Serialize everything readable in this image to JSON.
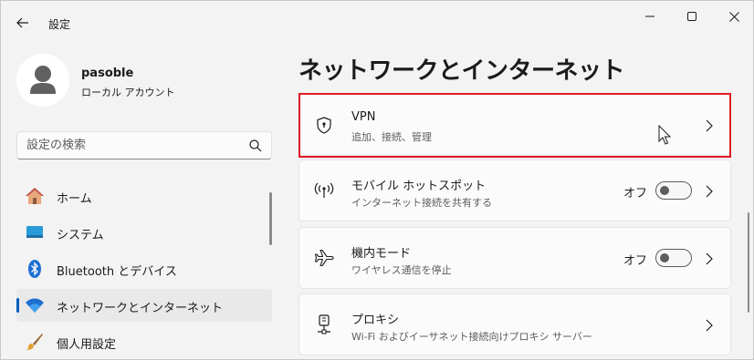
{
  "titlebar": {
    "title": "設定",
    "icons": {
      "back": "back-arrow-icon",
      "minimize": "minimize-icon",
      "maximize": "maximize-icon",
      "close": "close-icon"
    }
  },
  "user": {
    "name": "pasoble",
    "account_type": "ローカル アカウント"
  },
  "search": {
    "placeholder": "設定の検索",
    "value": ""
  },
  "sidebar": {
    "items": [
      {
        "label": "ホーム",
        "icon": "home-icon",
        "selected": false
      },
      {
        "label": "システム",
        "icon": "system-display-icon",
        "selected": false
      },
      {
        "label": "Bluetooth とデバイス",
        "icon": "bluetooth-icon",
        "selected": false
      },
      {
        "label": "ネットワークとインターネット",
        "icon": "wifi-icon",
        "selected": true
      },
      {
        "label": "個人用設定",
        "icon": "paintbrush-icon",
        "selected": false
      }
    ]
  },
  "main": {
    "title": "ネットワークとインターネット",
    "cards": [
      {
        "title": "VPN",
        "subtitle": "追加、接続、管理",
        "icon": "vpn-shield-icon",
        "highlighted": true
      },
      {
        "title": "モバイル ホットスポット",
        "subtitle": "インターネット接続を共有する",
        "icon": "hotspot-icon",
        "toggle_label": "オフ",
        "toggle_on": false
      },
      {
        "title": "機内モード",
        "subtitle": "ワイヤレス通信を停止",
        "icon": "airplane-icon",
        "toggle_label": "オフ",
        "toggle_on": false
      },
      {
        "title": "プロキシ",
        "subtitle": "Wi-Fi およびイーサネット接続向けプロキシ サーバー",
        "icon": "proxy-icon"
      }
    ]
  },
  "colors": {
    "accent": "#005fb8",
    "highlight_border": "#e01b24",
    "background": "#f3f3f3",
    "card": "#fbfbfb"
  }
}
